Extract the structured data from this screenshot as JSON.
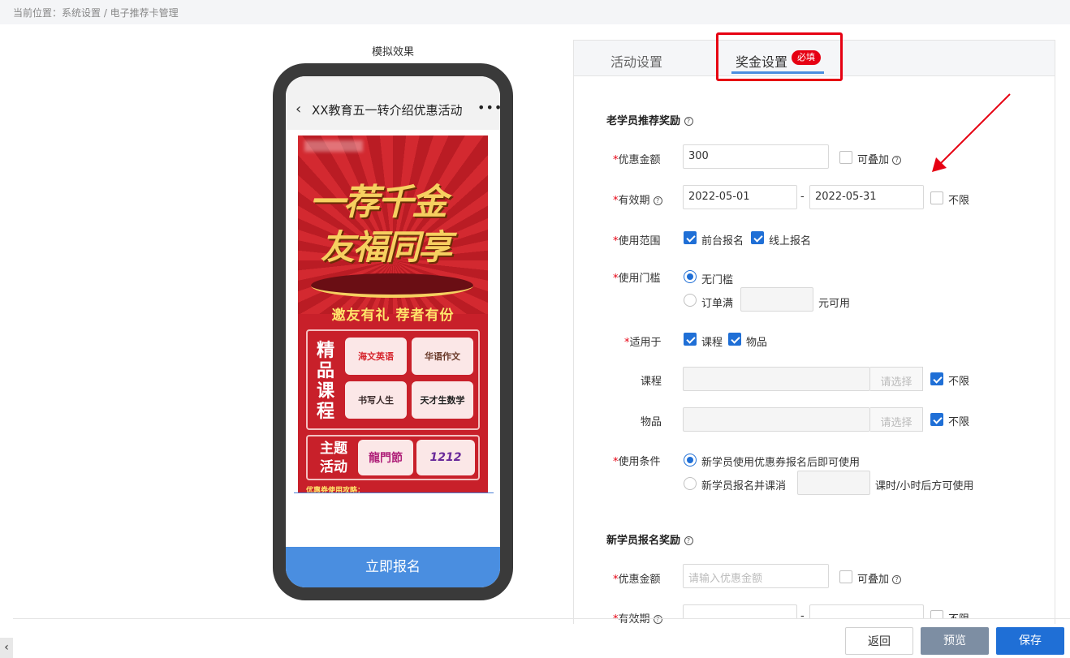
{
  "breadcrumb": "当前位置：系统设置 / 电子推荐卡管理",
  "simulation": {
    "title": "模拟效果",
    "phone_title": "XX教育五一转介绍优惠活动",
    "back_icon": "‹",
    "more_icon": "•••",
    "poster": {
      "headline_1": "一荐千金",
      "headline_2": "友福同享",
      "slogan": "邀友有礼  荐者有份",
      "section_1_label": "精品课程",
      "tiles": [
        "海文英语",
        "华语作文",
        "书写人生",
        "天才生数学"
      ],
      "section_2_label": "主题活动",
      "tiles_2": [
        "龍門節",
        "1212"
      ],
      "footer": "优惠券使用攻略："
    },
    "signup_button": "立即报名"
  },
  "tabs": [
    {
      "label": "活动设置"
    },
    {
      "label": "奖金设置",
      "badge": "必填"
    }
  ],
  "old_student": {
    "section_title": "老学员推荐奖励",
    "help_icon": "?",
    "discount_label": "优惠金额",
    "discount_value": "300",
    "stackable_label": "可叠加",
    "validity_label": "有效期",
    "date_start": "2022-05-01",
    "date_sep": "-",
    "date_end": "2022-05-31",
    "unlimited_label": "不限",
    "scope_label": "使用范围",
    "scope_options": [
      "前台报名",
      "线上报名"
    ],
    "threshold_label": "使用门槛",
    "threshold_none": "无门槛",
    "threshold_order": "订单满",
    "threshold_suffix": "元可用",
    "applies_label": "适用于",
    "applies_options": [
      "课程",
      "物品"
    ],
    "course_label": "课程",
    "item_label": "物品",
    "select_label": "请选择",
    "condition_label": "使用条件",
    "condition_1": "新学员使用优惠券报名后即可使用",
    "condition_2": "新学员报名并课消",
    "condition_2_suffix": "课时/小时后方可使用",
    "required_mark": "*"
  },
  "new_student": {
    "section_title": "新学员报名奖励",
    "discount_label": "优惠金额",
    "discount_placeholder": "请输入优惠金额",
    "stackable_label": "可叠加",
    "validity_label": "有效期",
    "unlimited_label": "不限"
  },
  "footer_buttons": {
    "back": "返回",
    "preview": "预览",
    "save": "保存"
  },
  "colors": {
    "primary": "#1f6fd6",
    "required": "#e60012",
    "annotation": "#e60012"
  }
}
